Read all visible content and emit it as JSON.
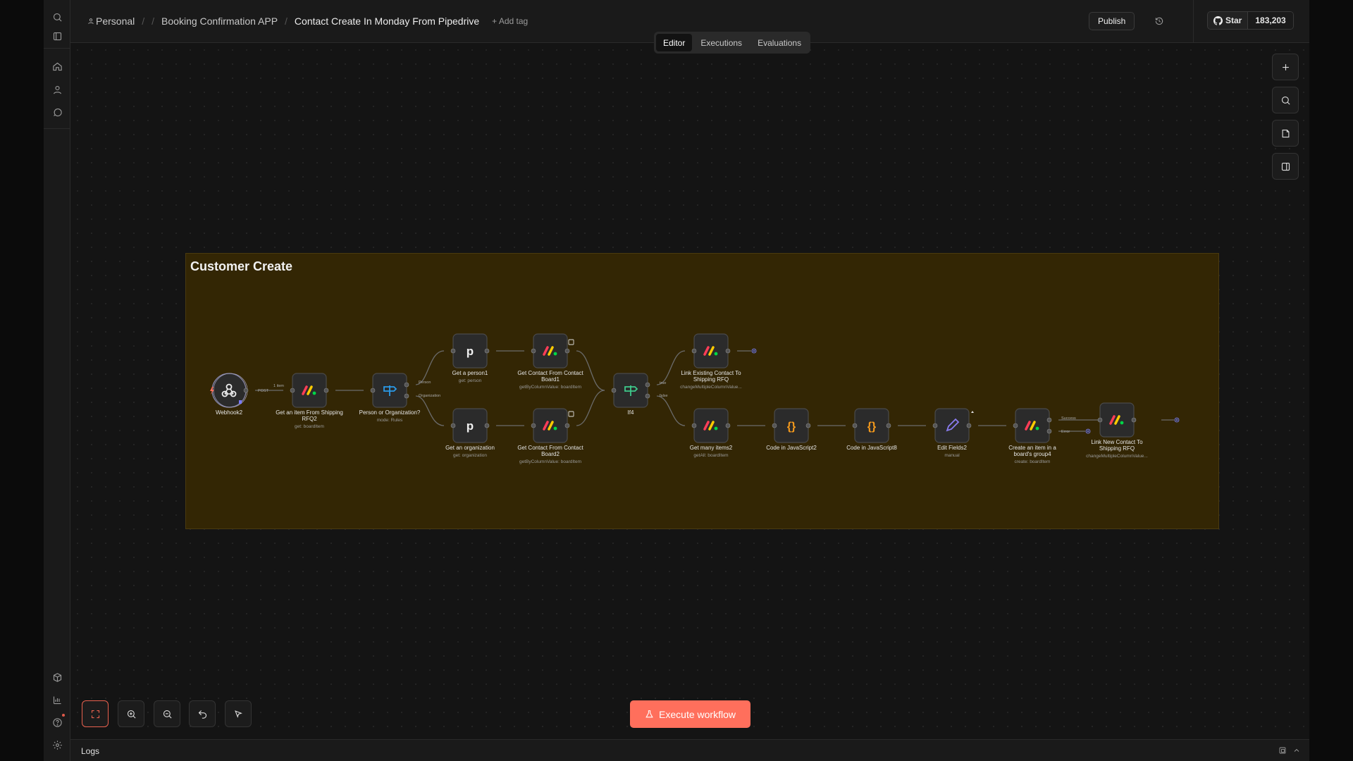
{
  "breadcrumb": {
    "project": "Personal",
    "folder": "Booking Confirmation APP",
    "workflow": "Contact Create In Monday From Pipedrive",
    "add_tag": "+ Add tag"
  },
  "header": {
    "publish_label": "Publish",
    "github_star_label": "Star",
    "github_star_count": "183,203"
  },
  "tabs": [
    {
      "label": "Editor",
      "active": true
    },
    {
      "label": "Executions",
      "active": false
    },
    {
      "label": "Evaluations",
      "active": false
    }
  ],
  "sticky_note": {
    "title": "Customer Create",
    "color": "#332604"
  },
  "nodes": [
    {
      "name": "Webhook2",
      "subtitle": "",
      "icon": "webhook-icon"
    },
    {
      "name": "Get an item From Shipping RFQ2",
      "subtitle": "get: boardItem",
      "icon": "monday-icon"
    },
    {
      "name": "Person or Organization?",
      "subtitle": "mode: Rules",
      "icon": "switch-icon"
    },
    {
      "name": "Get a person1",
      "subtitle": "get: person",
      "icon": "pipedrive-icon"
    },
    {
      "name": "Get an organization",
      "subtitle": "get: organization",
      "icon": "pipedrive-icon"
    },
    {
      "name": "Get Contact From Contact Board1",
      "subtitle": "getByColumnValue: boardItem",
      "icon": "monday-icon"
    },
    {
      "name": "Get Contact From Contact Board2",
      "subtitle": "getByColumnValue: boardItem",
      "icon": "monday-icon"
    },
    {
      "name": "If4",
      "subtitle": "",
      "icon": "if-icon"
    },
    {
      "name": "Link Existing Contact To Shipping RFQ",
      "subtitle": "changeMultipleColumnValue...",
      "icon": "monday-icon"
    },
    {
      "name": "Get many items2",
      "subtitle": "getAll: boardItem",
      "icon": "monday-icon"
    },
    {
      "name": "Code in JavaScript2",
      "subtitle": "",
      "icon": "code-icon"
    },
    {
      "name": "Code in JavaScript8",
      "subtitle": "",
      "icon": "code-icon"
    },
    {
      "name": "Edit Fields2",
      "subtitle": "manual",
      "icon": "pen-icon"
    },
    {
      "name": "Create an item in a board's group4",
      "subtitle": "create: boardItem",
      "icon": "monday-icon"
    },
    {
      "name": "Link New Contact To Shipping RFQ",
      "subtitle": "changeMultipleColumnValue...",
      "icon": "monday-icon"
    }
  ],
  "edge_labels": {
    "webhook_out": "POST",
    "items": "1 item",
    "switch_person": "Person",
    "switch_org": "Organization",
    "if_true": "true",
    "if_false": "false",
    "create_success": "Success",
    "create_error": "Error"
  },
  "execute_button": "Execute workflow",
  "logs_label": "Logs",
  "colors": {
    "accent": "#ff6f5c",
    "sticky": "#332604",
    "switch": "#2b9ae8",
    "if": "#3ec98b",
    "code": "#f59a1c",
    "edit": "#8a7cf0"
  }
}
